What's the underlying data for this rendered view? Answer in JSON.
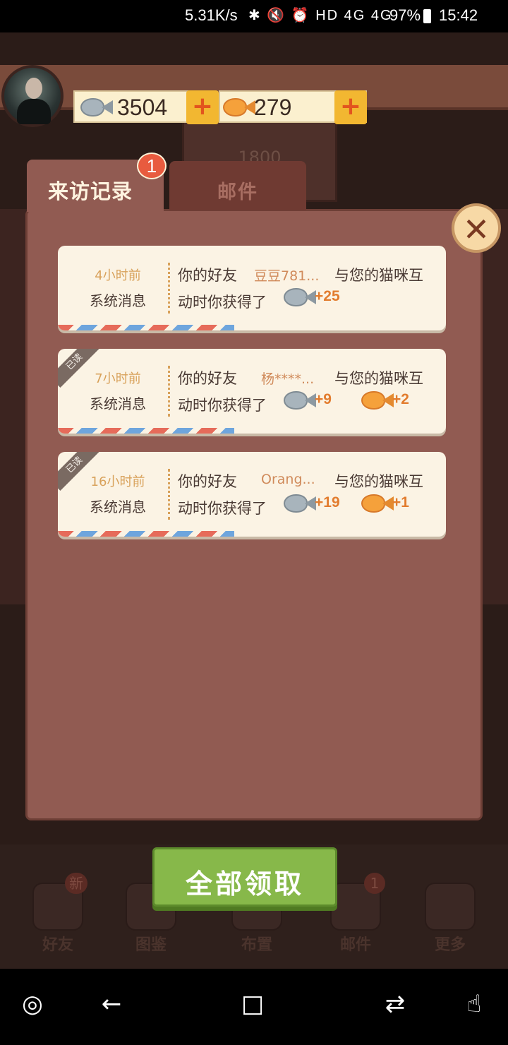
{
  "status_bar": {
    "net_speed": "5.31K/s",
    "icons": "✱ 🔇 ⏰ HD 4G 4G",
    "battery": "97%",
    "time": "15:42"
  },
  "currency": {
    "silver": "3504",
    "gold": "279"
  },
  "background": {
    "sign_text": "1800"
  },
  "tabs": {
    "visits": "来访记录",
    "mail": "邮件",
    "visits_badge": "1"
  },
  "messages": [
    {
      "time": "4小时前",
      "source": "系统消息",
      "prefix": "你的好友",
      "friend": "豆豆781...",
      "suffix": "与您的猫咪互",
      "line2": "动时你获得了",
      "silver_reward": "+25",
      "gold_reward": "",
      "read_tag": ""
    },
    {
      "time": "7小时前",
      "source": "系统消息",
      "prefix": "你的好友",
      "friend": "杨****...",
      "suffix": "与您的猫咪互",
      "line2": "动时你获得了",
      "silver_reward": "+9",
      "gold_reward": "+2",
      "read_tag": "已读"
    },
    {
      "time": "16小时前",
      "source": "系统消息",
      "prefix": "你的好友",
      "friend": "Orang...",
      "suffix": "与您的猫咪互",
      "line2": "动时你获得了",
      "silver_reward": "+19",
      "gold_reward": "+1",
      "read_tag": "已读"
    }
  ],
  "claim_button": "全部领取",
  "bottom_nav": {
    "friends": "好友",
    "friends_badge": "新",
    "atlas": "图鉴",
    "layout": "布置",
    "mail": "邮件",
    "mail_badge": "1",
    "more": "更多"
  },
  "close_symbol": "✕"
}
